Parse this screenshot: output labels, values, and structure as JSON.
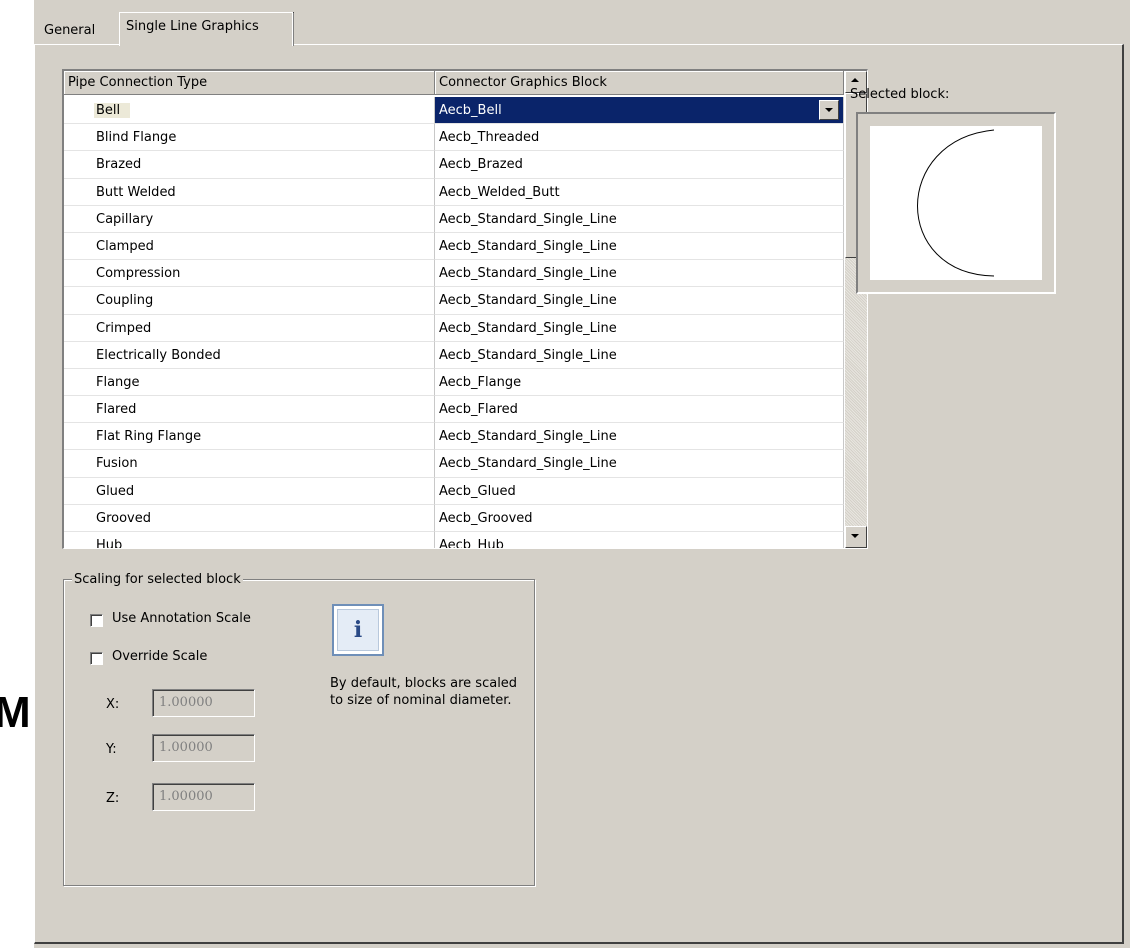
{
  "tabs": [
    {
      "label": "General",
      "active": false
    },
    {
      "label": "Single Line Graphics",
      "active": true
    }
  ],
  "clipped_glyph": "M",
  "grid": {
    "columns": [
      "Pipe Connection Type",
      "Connector Graphics Block"
    ],
    "selected_index": 0,
    "rows": [
      {
        "type": "Bell",
        "block": "Aecb_Bell"
      },
      {
        "type": "Blind Flange",
        "block": "Aecb_Threaded"
      },
      {
        "type": "Brazed",
        "block": "Aecb_Brazed"
      },
      {
        "type": "Butt Welded",
        "block": "Aecb_Welded_Butt"
      },
      {
        "type": "Capillary",
        "block": "Aecb_Standard_Single_Line"
      },
      {
        "type": "Clamped",
        "block": "Aecb_Standard_Single_Line"
      },
      {
        "type": "Compression",
        "block": "Aecb_Standard_Single_Line"
      },
      {
        "type": "Coupling",
        "block": "Aecb_Standard_Single_Line"
      },
      {
        "type": "Crimped",
        "block": "Aecb_Standard_Single_Line"
      },
      {
        "type": "Electrically Bonded",
        "block": "Aecb_Standard_Single_Line"
      },
      {
        "type": "Flange",
        "block": "Aecb_Flange"
      },
      {
        "type": "Flared",
        "block": "Aecb_Flared"
      },
      {
        "type": "Flat Ring Flange",
        "block": "Aecb_Standard_Single_Line"
      },
      {
        "type": "Fusion",
        "block": "Aecb_Standard_Single_Line"
      },
      {
        "type": "Glued",
        "block": "Aecb_Glued"
      },
      {
        "type": "Grooved",
        "block": "Aecb_Grooved"
      },
      {
        "type": "Hub",
        "block": "Aecb_Hub"
      }
    ]
  },
  "preview": {
    "label": "Selected block:",
    "icon": "bell-arc-graphic"
  },
  "scaling": {
    "title": "Scaling for selected block",
    "use_annotation_scale": {
      "label": "Use Annotation Scale",
      "checked": false
    },
    "override_scale": {
      "label": "Override Scale",
      "checked": false
    },
    "x": {
      "label": "X:",
      "value": "1.00000"
    },
    "y": {
      "label": "Y:",
      "value": "1.00000"
    },
    "z": {
      "label": "Z:",
      "value": "1.00000"
    },
    "info_icon_glyph": "i",
    "info_text": "By default, blocks are scaled to size of nominal diameter."
  }
}
